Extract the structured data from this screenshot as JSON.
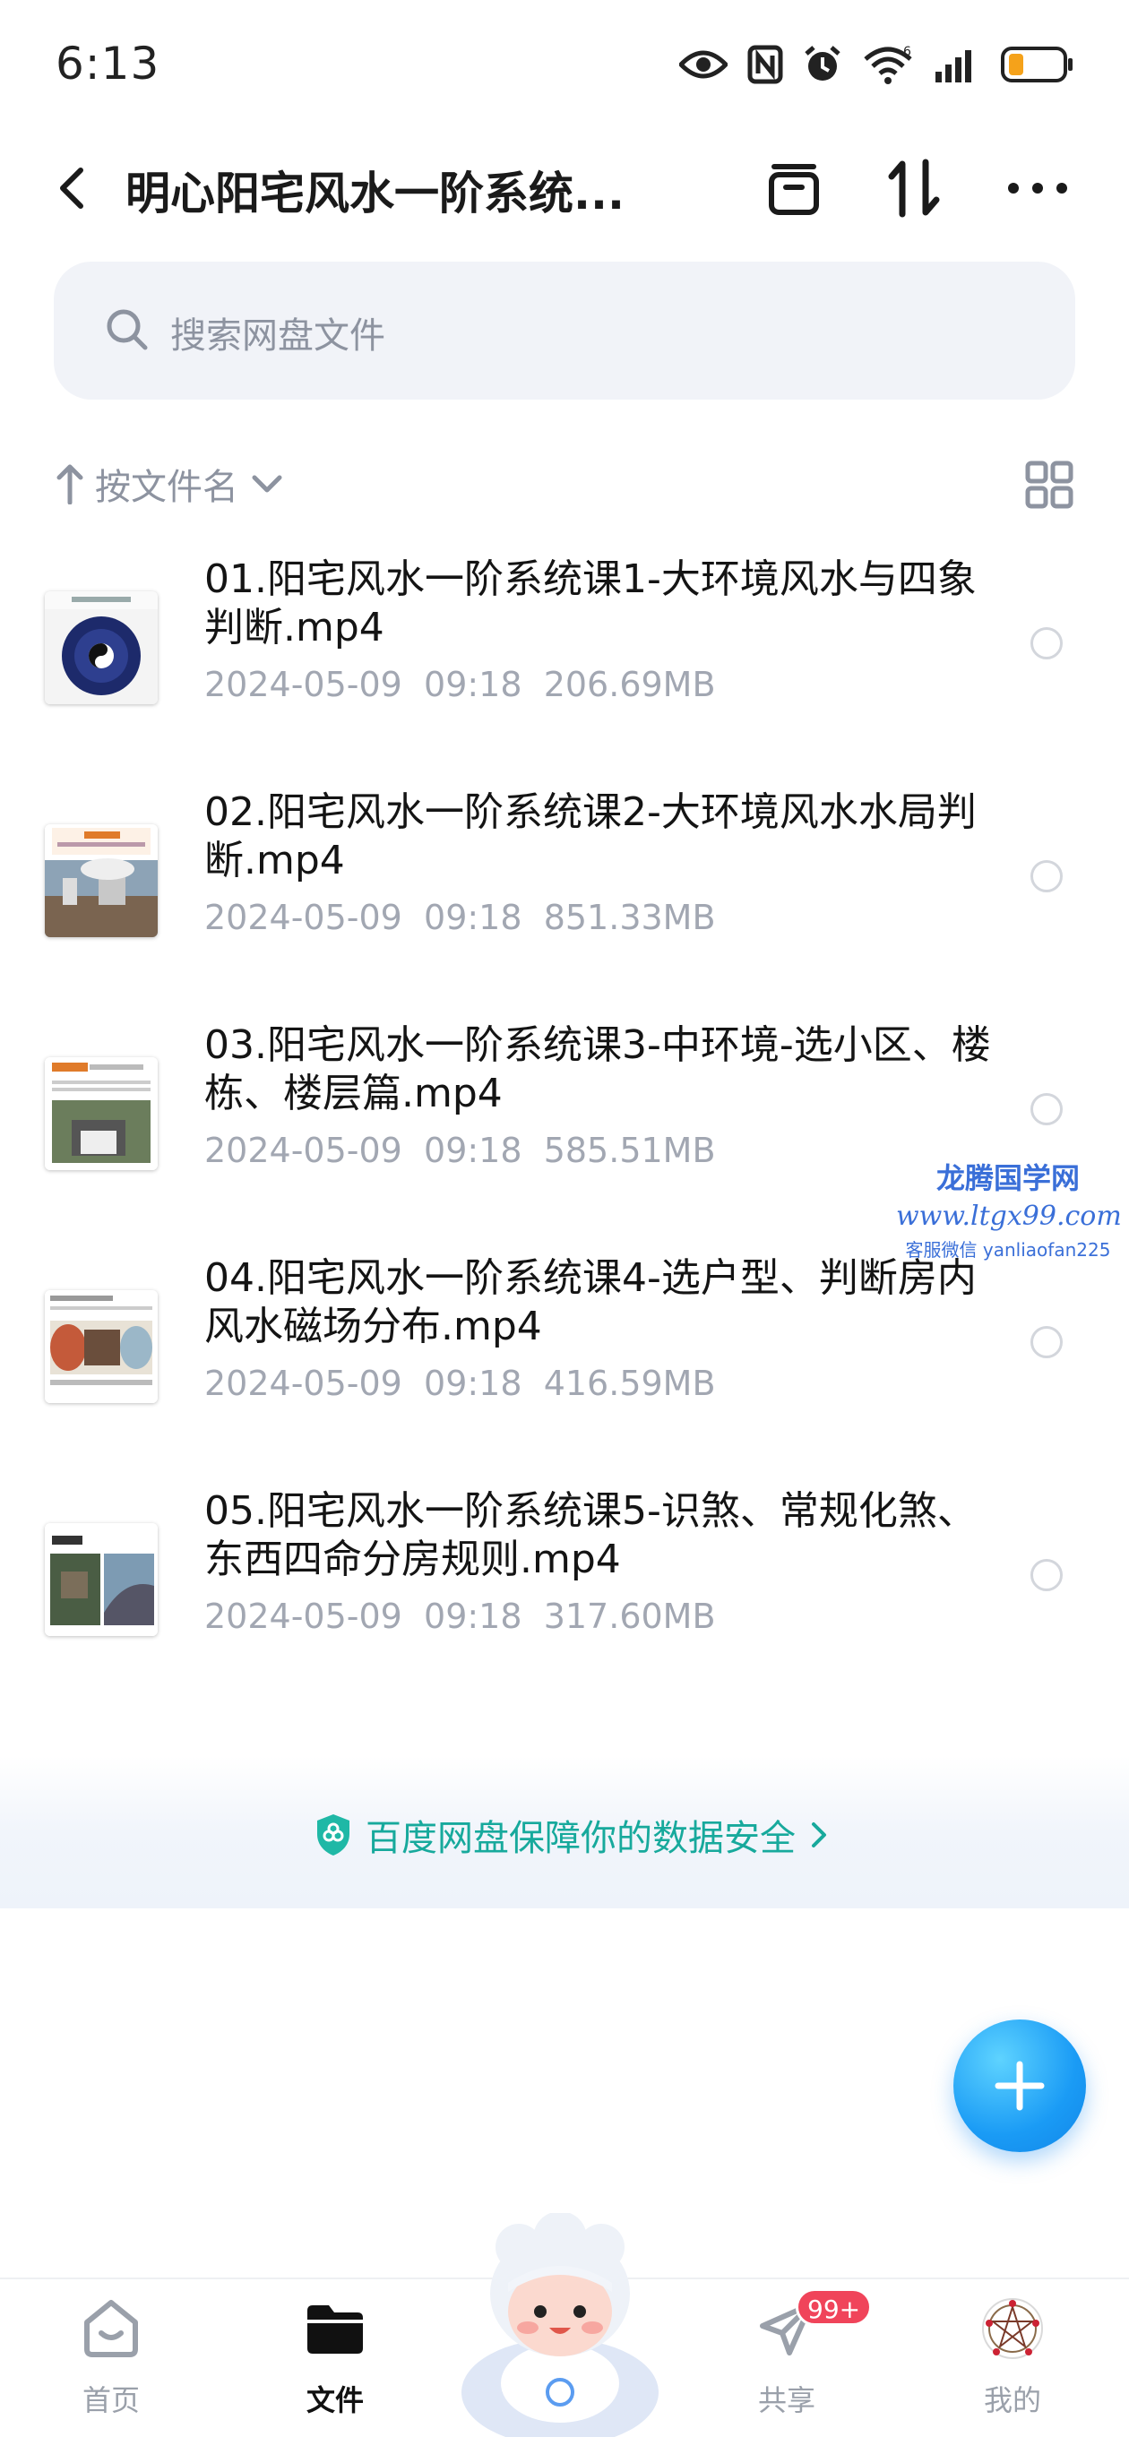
{
  "status_bar": {
    "time": "6:13"
  },
  "header": {
    "title": "明心阳宅风水一阶系统..."
  },
  "search": {
    "placeholder": "搜索网盘文件"
  },
  "sort": {
    "label": "按文件名"
  },
  "files": [
    {
      "name": "01.阳宅风水一阶系统课1-大环境风水与四象判断.mp4",
      "date": "2024-05-09",
      "time": "09:18",
      "size": "206.69MB"
    },
    {
      "name": "02.阳宅风水一阶系统课2-大环境风水水局判断.mp4",
      "date": "2024-05-09",
      "time": "09:18",
      "size": "851.33MB"
    },
    {
      "name": "03.阳宅风水一阶系统课3-中环境-选小区、楼栋、楼层篇.mp4",
      "date": "2024-05-09",
      "time": "09:18",
      "size": "585.51MB"
    },
    {
      "name": "04.阳宅风水一阶系统课4-选户型、判断房内风水磁场分布.mp4",
      "date": "2024-05-09",
      "time": "09:18",
      "size": "416.59MB"
    },
    {
      "name": "05.阳宅风水一阶系统课5-识煞、常规化煞、东西四命分房规则.mp4",
      "date": "2024-05-09",
      "time": "09:18",
      "size": "317.60MB"
    }
  ],
  "watermark": {
    "line1": "龙腾国学网",
    "line2": "www.ltgx99.com",
    "line3": "客服微信 yanliaofan225"
  },
  "security": {
    "text": "百度网盘保障你的数据安全"
  },
  "bottom_nav": {
    "items": [
      {
        "label": "首页"
      },
      {
        "label": "文件"
      },
      {
        "label": "共享"
      },
      {
        "label": "我的"
      }
    ],
    "share_badge": "99+"
  },
  "colors": {
    "accent": "#1a9bf5",
    "security_text": "#17a99c",
    "badge": "#f0445a"
  }
}
